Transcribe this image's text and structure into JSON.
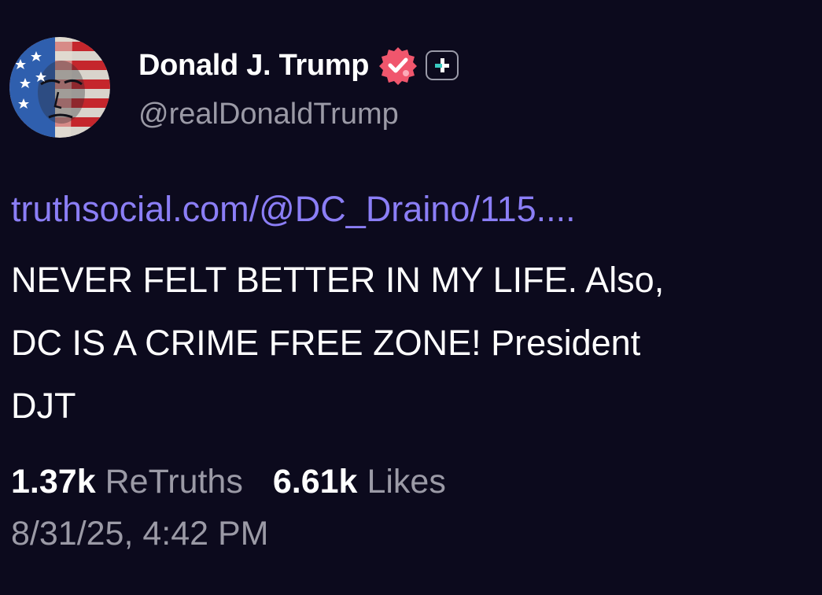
{
  "author": {
    "display_name": "Donald J. Trump",
    "handle": "@realDonaldTrump",
    "avatar_icon": "user-avatar",
    "verified_icon": "verified-badge-icon",
    "plus_icon": "plus-badge-icon"
  },
  "post": {
    "link_text": "truthsocial.com/@DC_Draino/115....",
    "body_lines": [
      "NEVER FELT BETTER IN MY LIFE. Also,",
      "DC IS A CRIME FREE ZONE! President",
      "DJT"
    ]
  },
  "stats": {
    "retruths_count": "1.37k",
    "retruths_label": "ReTruths",
    "likes_count": "6.61k",
    "likes_label": "Likes"
  },
  "timestamp": "8/31/25, 4:42 PM",
  "colors": {
    "background": "#0c0a1d",
    "link": "#8b7ef6",
    "muted_text": "#9b9aa6",
    "verified_badge": "#f0566d"
  }
}
